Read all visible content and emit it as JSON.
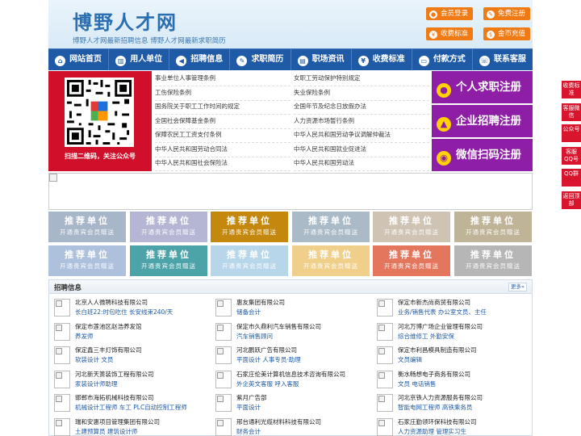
{
  "header": {
    "title": "博野人才网",
    "subtitle": "博野人才网最新招聘信息    博野人才网最新求职简历",
    "member_login": "会员登录",
    "free_register": "免费注册",
    "fee_standard": "收费标准",
    "coin_recharge": "金币充值"
  },
  "nav": {
    "items": [
      {
        "label": "网站首页",
        "icon": "home-icon"
      },
      {
        "label": "用人单位",
        "icon": "building-icon"
      },
      {
        "label": "招聘信息",
        "icon": "megaphone-icon"
      },
      {
        "label": "求职简历",
        "icon": "resume-icon"
      },
      {
        "label": "职场资讯",
        "icon": "news-icon"
      },
      {
        "label": "收费标准",
        "icon": "coin-icon"
      },
      {
        "label": "付款方式",
        "icon": "card-icon"
      },
      {
        "label": "联系客服",
        "icon": "phone-icon"
      }
    ]
  },
  "qr": {
    "caption": "扫描二维码，关注公众号"
  },
  "regulations": {
    "left": [
      "事业单位人事管理条例",
      "工伤保险条例",
      "国务院关于职工工作时间的规定",
      "全国社会保障基金条例",
      "保障农民工工资支付条例",
      "中华人民共和国劳动合同法",
      "中华人民共和国社会保险法"
    ],
    "right": [
      "女职工劳动保护特别规定",
      "失业保险条例",
      "全国年节及纪念日放假办法",
      "人力资源市场暂行条例",
      "中华人民共和国劳动争议调解仲裁法",
      "中华人民共和国就业促进法",
      "中华人民共和国劳动法"
    ]
  },
  "registers": {
    "personal": "个人求职注册",
    "company": "企业招聘注册",
    "wechat": "微信扫码注册"
  },
  "side_tabs": [
    "收费标准",
    "客服微信",
    "公众号",
    "客服QQ号",
    "QQ群",
    "返回顶部"
  ],
  "sponsors": {
    "title": "推荐单位",
    "sub": "开通贵宾会员赠送",
    "colors": [
      "#a8b6c9",
      "#b5b6d3",
      "#c4880f",
      "#aabbc7",
      "#cfc3b3",
      "#bfb497",
      "#adc1dd",
      "#b2c3d0",
      "#4da4a8",
      "#b8d6ea",
      "#f0cf8a",
      "#e5765e",
      "#b6b6b6"
    ]
  },
  "jobs": {
    "title": "招聘信息",
    "more": "更多»",
    "columns": [
      [
        {
          "company": "北京人人微聘科技有限公司",
          "positions": "长白班22:时包吃住 长安线束240/天"
        },
        {
          "company": "保定市莲池区赵浩养发馆",
          "positions": "养发师"
        },
        {
          "company": "保定鑫三丰灯饰有限公司",
          "positions": "软装设计 文员"
        },
        {
          "company": "河北新天箦装饰工程有限公司",
          "positions": "家装设计师助理"
        },
        {
          "company": "邯郸市海拓机械科技有限公司",
          "positions": "机械设计工程师 车工 PLC自动控制工程师"
        },
        {
          "company": "瑞和安惠项目管理集团有限公司",
          "positions": "土建预算员 建筑设计师"
        }
      ],
      [
        {
          "company": "惠友集团有限公司",
          "positions": "储备会计"
        },
        {
          "company": "保定市久鼎利汽车销售有限公司",
          "positions": "汽车销售顾问"
        },
        {
          "company": "河北鹏跃广告有限公司",
          "positions": "平面设计 人事专员·助理"
        },
        {
          "company": "石家庄伦美计算机信息技术咨询有限公司",
          "positions": "外企英文客服 呼入客服"
        },
        {
          "company": "紫月广告部",
          "positions": "平面设计"
        },
        {
          "company": "邢台通利光缆材料科技有限公司",
          "positions": "财务会计"
        }
      ],
      [
        {
          "company": "保定市新杰尚商贸有限公司",
          "positions": "业务/销售代表 办公室文员、主任"
        },
        {
          "company": "河北万博广场企业管理有限公司",
          "positions": "综合维修工 外勤安保"
        },
        {
          "company": "保定市利昌模具制造有限公司",
          "positions": "文员编辑"
        },
        {
          "company": "衡水畅想电子商务有限公司",
          "positions": "文员 电话销售"
        },
        {
          "company": "河北京铁人力资源服务有限公司",
          "positions": "智能电网工程师 高铁乘务员"
        },
        {
          "company": "石家庄勤领环保科技有限公司",
          "positions": "人力资源助理 管理实习生"
        }
      ]
    ]
  }
}
